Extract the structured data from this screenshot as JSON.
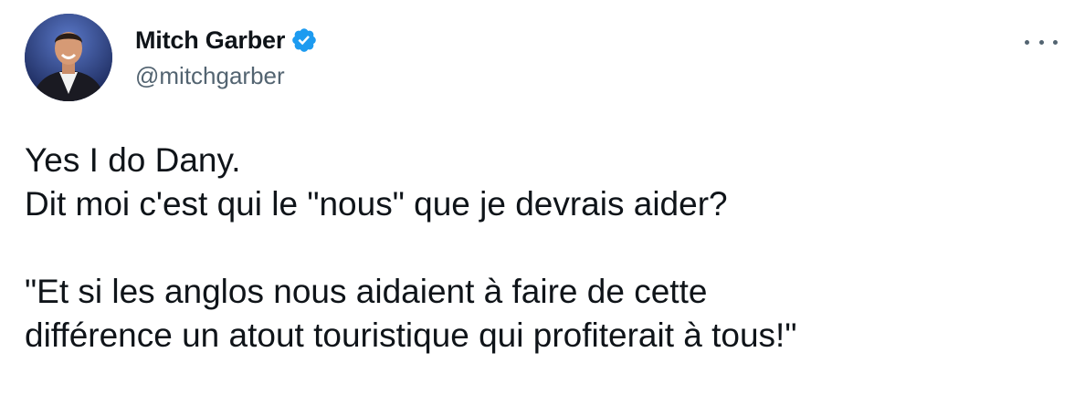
{
  "author": {
    "name": "Mitch Garber",
    "handle": "@mitchgarber",
    "verified": true,
    "avatar_icon": "profile-photo"
  },
  "more_icon": "ellipsis-icon",
  "colors": {
    "text_primary": "#0f1419",
    "text_secondary": "#536471",
    "verified_badge": "#1d9bf0"
  },
  "tweet": {
    "lines": [
      "Yes I do Dany.",
      "Dit moi c'est qui le \"nous\" que je devrais aider?",
      "",
      "\"Et si les anglos nous aidaient à faire de cette",
      "différence un atout touristique qui profiterait à tous!\""
    ]
  }
}
